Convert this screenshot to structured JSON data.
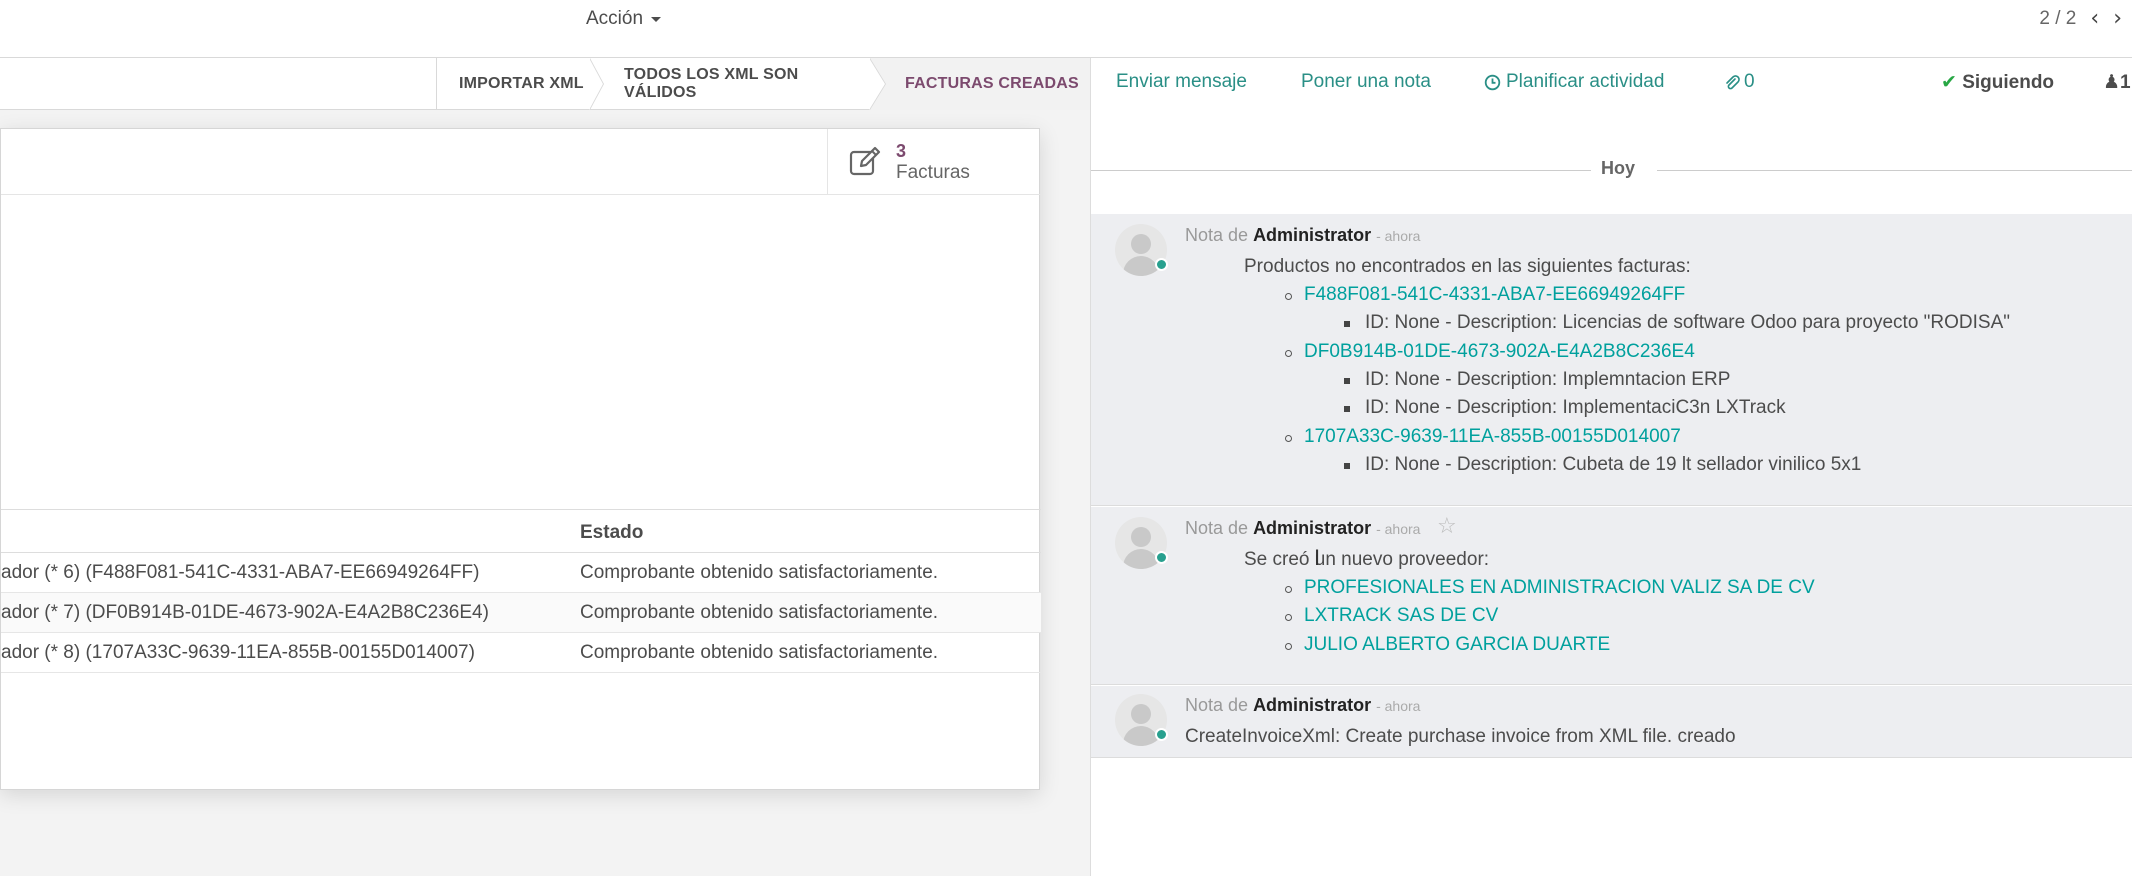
{
  "topbar": {
    "action_label": "Acción",
    "pager": "2 / 2"
  },
  "statusbar": {
    "stages": [
      "IMPORTAR XML",
      "TODOS LOS XML SON VÁLIDOS",
      "FACTURAS CREADAS"
    ]
  },
  "smart_button": {
    "count": "3",
    "label": "Facturas"
  },
  "table": {
    "header_estado": "Estado",
    "rows": [
      {
        "name": "ador (* 6) (F488F081-541C-4331-ABA7-EE66949264FF)",
        "estado": "Comprobante obtenido satisfactoriamente."
      },
      {
        "name": "ador (* 7) (DF0B914B-01DE-4673-902A-E4A2B8C236E4)",
        "estado": "Comprobante obtenido satisfactoriamente."
      },
      {
        "name": "ador (* 8) (1707A33C-9639-11EA-855B-00155D014007)",
        "estado": "Comprobante obtenido satisfactoriamente."
      }
    ]
  },
  "chatter": {
    "send_message": "Enviar mensaje",
    "log_note": "Poner una nota",
    "schedule": "Planificar actividad",
    "attachments": "0",
    "following": "Siguiendo",
    "followers": "1",
    "today": "Hoy",
    "messages": [
      {
        "prefix": "Nota de",
        "author": "Administrator",
        "time": "- ahora",
        "intro": "Productos no encontrados en las siguientes facturas:",
        "items": [
          {
            "link": "F488F081-541C-4331-ABA7-EE66949264FF",
            "sub": [
              "ID: None - Description: Licencias de software Odoo para proyecto \"RODISA\""
            ]
          },
          {
            "link": "DF0B914B-01DE-4673-902A-E4A2B8C236E4",
            "sub": [
              "ID: None - Description: Implemntacion ERP",
              "ID: None - Description: ImplementaciC3n LXTrack"
            ]
          },
          {
            "link": "1707A33C-9639-11EA-855B-00155D014007",
            "sub": [
              "ID: None - Description: Cubeta de 19 lt sellador vinilico 5x1"
            ]
          }
        ]
      },
      {
        "prefix": "Nota de",
        "author": "Administrator",
        "time": "- ahora",
        "intro": "Se creó un nuevo proveedor:",
        "items": [
          {
            "link": "PROFESIONALES EN ADMINISTRACION VALIZ SA DE CV"
          },
          {
            "link": "LXTRACK SAS DE CV"
          },
          {
            "link": "JULIO ALBERTO GARCIA DUARTE"
          }
        ]
      },
      {
        "prefix": "Nota de",
        "author": "Administrator",
        "time": "- ahora",
        "intro": "CreateInvoiceXml: Create purchase invoice from XML file. creado"
      }
    ]
  }
}
